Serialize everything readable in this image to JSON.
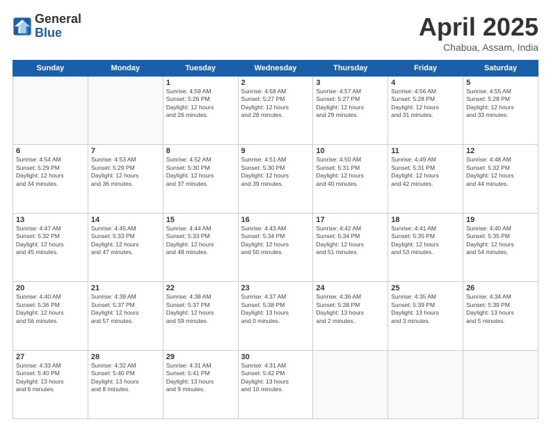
{
  "logo": {
    "general": "General",
    "blue": "Blue"
  },
  "title": "April 2025",
  "subtitle": "Chabua, Assam, India",
  "headers": [
    "Sunday",
    "Monday",
    "Tuesday",
    "Wednesday",
    "Thursday",
    "Friday",
    "Saturday"
  ],
  "weeks": [
    [
      {
        "day": "",
        "info": ""
      },
      {
        "day": "",
        "info": ""
      },
      {
        "day": "1",
        "info": "Sunrise: 4:59 AM\nSunset: 5:26 PM\nDaylight: 12 hours\nand 26 minutes."
      },
      {
        "day": "2",
        "info": "Sunrise: 4:58 AM\nSunset: 5:27 PM\nDaylight: 12 hours\nand 28 minutes."
      },
      {
        "day": "3",
        "info": "Sunrise: 4:57 AM\nSunset: 5:27 PM\nDaylight: 12 hours\nand 29 minutes."
      },
      {
        "day": "4",
        "info": "Sunrise: 4:56 AM\nSunset: 5:28 PM\nDaylight: 12 hours\nand 31 minutes."
      },
      {
        "day": "5",
        "info": "Sunrise: 4:55 AM\nSunset: 5:28 PM\nDaylight: 12 hours\nand 33 minutes."
      }
    ],
    [
      {
        "day": "6",
        "info": "Sunrise: 4:54 AM\nSunset: 5:29 PM\nDaylight: 12 hours\nand 34 minutes."
      },
      {
        "day": "7",
        "info": "Sunrise: 4:53 AM\nSunset: 5:29 PM\nDaylight: 12 hours\nand 36 minutes."
      },
      {
        "day": "8",
        "info": "Sunrise: 4:52 AM\nSunset: 5:30 PM\nDaylight: 12 hours\nand 37 minutes."
      },
      {
        "day": "9",
        "info": "Sunrise: 4:51 AM\nSunset: 5:30 PM\nDaylight: 12 hours\nand 39 minutes."
      },
      {
        "day": "10",
        "info": "Sunrise: 4:50 AM\nSunset: 5:31 PM\nDaylight: 12 hours\nand 40 minutes."
      },
      {
        "day": "11",
        "info": "Sunrise: 4:49 AM\nSunset: 5:31 PM\nDaylight: 12 hours\nand 42 minutes."
      },
      {
        "day": "12",
        "info": "Sunrise: 4:48 AM\nSunset: 5:32 PM\nDaylight: 12 hours\nand 44 minutes."
      }
    ],
    [
      {
        "day": "13",
        "info": "Sunrise: 4:47 AM\nSunset: 5:32 PM\nDaylight: 12 hours\nand 45 minutes."
      },
      {
        "day": "14",
        "info": "Sunrise: 4:45 AM\nSunset: 5:33 PM\nDaylight: 12 hours\nand 47 minutes."
      },
      {
        "day": "15",
        "info": "Sunrise: 4:44 AM\nSunset: 5:33 PM\nDaylight: 12 hours\nand 48 minutes."
      },
      {
        "day": "16",
        "info": "Sunrise: 4:43 AM\nSunset: 5:34 PM\nDaylight: 12 hours\nand 50 minutes."
      },
      {
        "day": "17",
        "info": "Sunrise: 4:42 AM\nSunset: 5:34 PM\nDaylight: 12 hours\nand 51 minutes."
      },
      {
        "day": "18",
        "info": "Sunrise: 4:41 AM\nSunset: 5:35 PM\nDaylight: 12 hours\nand 53 minutes."
      },
      {
        "day": "19",
        "info": "Sunrise: 4:40 AM\nSunset: 5:35 PM\nDaylight: 12 hours\nand 54 minutes."
      }
    ],
    [
      {
        "day": "20",
        "info": "Sunrise: 4:40 AM\nSunset: 5:36 PM\nDaylight: 12 hours\nand 56 minutes."
      },
      {
        "day": "21",
        "info": "Sunrise: 4:39 AM\nSunset: 5:37 PM\nDaylight: 12 hours\nand 57 minutes."
      },
      {
        "day": "22",
        "info": "Sunrise: 4:38 AM\nSunset: 5:37 PM\nDaylight: 12 hours\nand 59 minutes."
      },
      {
        "day": "23",
        "info": "Sunrise: 4:37 AM\nSunset: 5:38 PM\nDaylight: 13 hours\nand 0 minutes."
      },
      {
        "day": "24",
        "info": "Sunrise: 4:36 AM\nSunset: 5:38 PM\nDaylight: 13 hours\nand 2 minutes."
      },
      {
        "day": "25",
        "info": "Sunrise: 4:35 AM\nSunset: 5:39 PM\nDaylight: 13 hours\nand 3 minutes."
      },
      {
        "day": "26",
        "info": "Sunrise: 4:34 AM\nSunset: 5:39 PM\nDaylight: 13 hours\nand 5 minutes."
      }
    ],
    [
      {
        "day": "27",
        "info": "Sunrise: 4:33 AM\nSunset: 5:40 PM\nDaylight: 13 hours\nand 6 minutes."
      },
      {
        "day": "28",
        "info": "Sunrise: 4:32 AM\nSunset: 5:40 PM\nDaylight: 13 hours\nand 8 minutes."
      },
      {
        "day": "29",
        "info": "Sunrise: 4:31 AM\nSunset: 5:41 PM\nDaylight: 13 hours\nand 9 minutes."
      },
      {
        "day": "30",
        "info": "Sunrise: 4:31 AM\nSunset: 5:42 PM\nDaylight: 13 hours\nand 10 minutes."
      },
      {
        "day": "",
        "info": ""
      },
      {
        "day": "",
        "info": ""
      },
      {
        "day": "",
        "info": ""
      }
    ]
  ]
}
